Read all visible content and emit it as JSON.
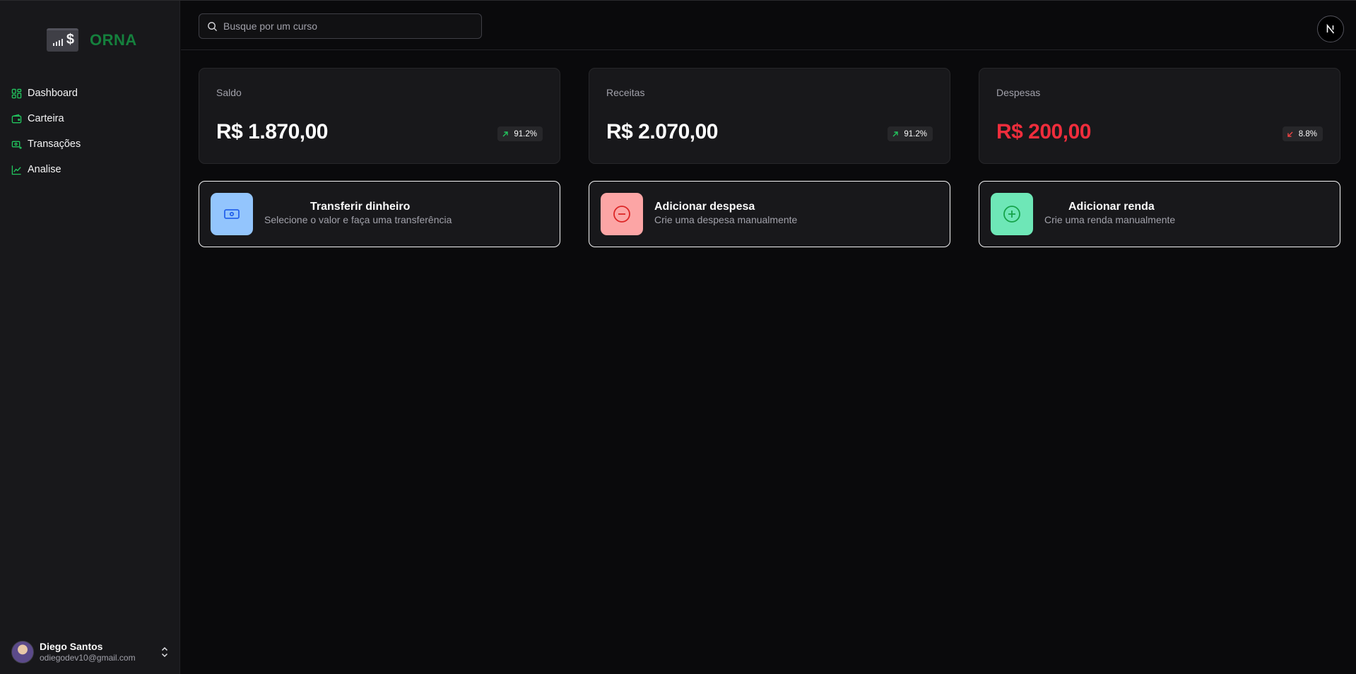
{
  "brand": {
    "name": "ORNA",
    "accent": "#15803d"
  },
  "sidebar": {
    "items": [
      {
        "label": "Dashboard",
        "icon": "dashboard-icon"
      },
      {
        "label": "Carteira",
        "icon": "wallet-icon"
      },
      {
        "label": "Transações",
        "icon": "transactions-icon"
      },
      {
        "label": "Analise",
        "icon": "chart-line-icon"
      }
    ]
  },
  "user": {
    "name": "Diego Santos",
    "email": "odiegodev10@gmail.com"
  },
  "search": {
    "placeholder": "Busque por um curso"
  },
  "stats": [
    {
      "label": "Saldo",
      "value": "R$ 1.870,00",
      "change": "91.2%",
      "trend": "up",
      "color": "#ffffff"
    },
    {
      "label": "Receitas",
      "value": "R$ 2.070,00",
      "change": "91.2%",
      "trend": "up",
      "color": "#ffffff"
    },
    {
      "label": "Despesas",
      "value": "R$ 200,00",
      "change": "8.8%",
      "trend": "down",
      "color": "#ef2d3c"
    }
  ],
  "actions": [
    {
      "title": "Transferir dinheiro",
      "subtitle": "Selecione o valor e faça uma transferência",
      "icon": "banknote-icon",
      "color": "#93c5fd"
    },
    {
      "title": "Adicionar despesa",
      "subtitle": "Crie uma despesa manualmente",
      "icon": "minus-circle-icon",
      "color": "#fca5a5"
    },
    {
      "title": "Adicionar renda",
      "subtitle": "Crie uma renda manualmente",
      "icon": "plus-circle-icon",
      "color": "#6ee7b7"
    }
  ]
}
